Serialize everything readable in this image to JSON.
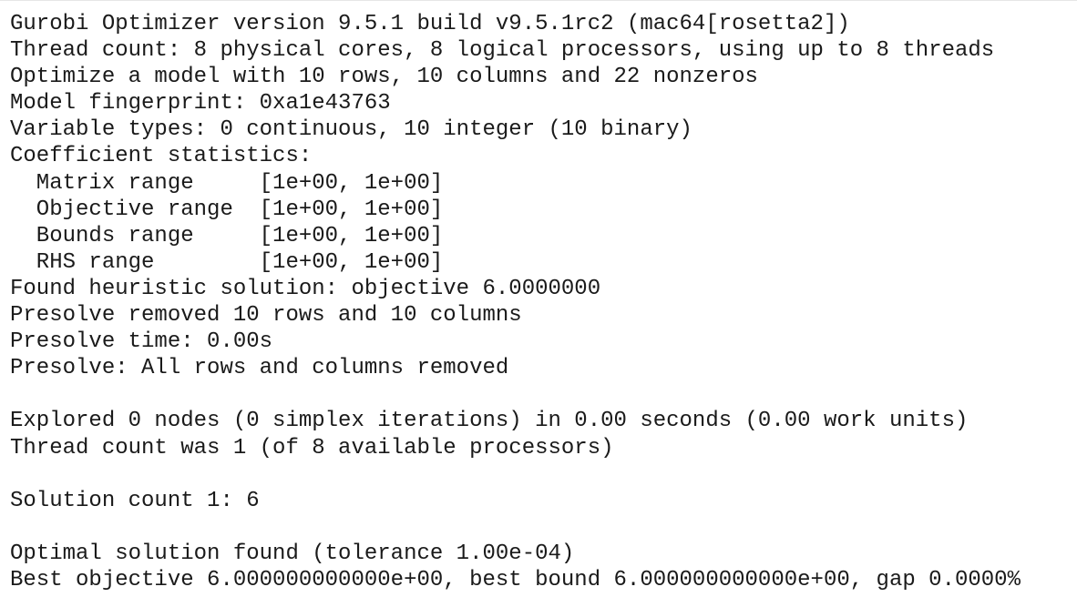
{
  "output": {
    "lines": [
      "Gurobi Optimizer version 9.5.1 build v9.5.1rc2 (mac64[rosetta2])",
      "Thread count: 8 physical cores, 8 logical processors, using up to 8 threads",
      "Optimize a model with 10 rows, 10 columns and 22 nonzeros",
      "Model fingerprint: 0xa1e43763",
      "Variable types: 0 continuous, 10 integer (10 binary)",
      "Coefficient statistics:",
      "  Matrix range     [1e+00, 1e+00]",
      "  Objective range  [1e+00, 1e+00]",
      "  Bounds range     [1e+00, 1e+00]",
      "  RHS range        [1e+00, 1e+00]",
      "Found heuristic solution: objective 6.0000000",
      "Presolve removed 10 rows and 10 columns",
      "Presolve time: 0.00s",
      "Presolve: All rows and columns removed",
      "",
      "Explored 0 nodes (0 simplex iterations) in 0.00 seconds (0.00 work units)",
      "Thread count was 1 (of 8 available processors)",
      "",
      "Solution count 1: 6",
      "",
      "Optimal solution found (tolerance 1.00e-04)",
      "Best objective 6.000000000000e+00, best bound 6.000000000000e+00, gap 0.0000%"
    ]
  }
}
